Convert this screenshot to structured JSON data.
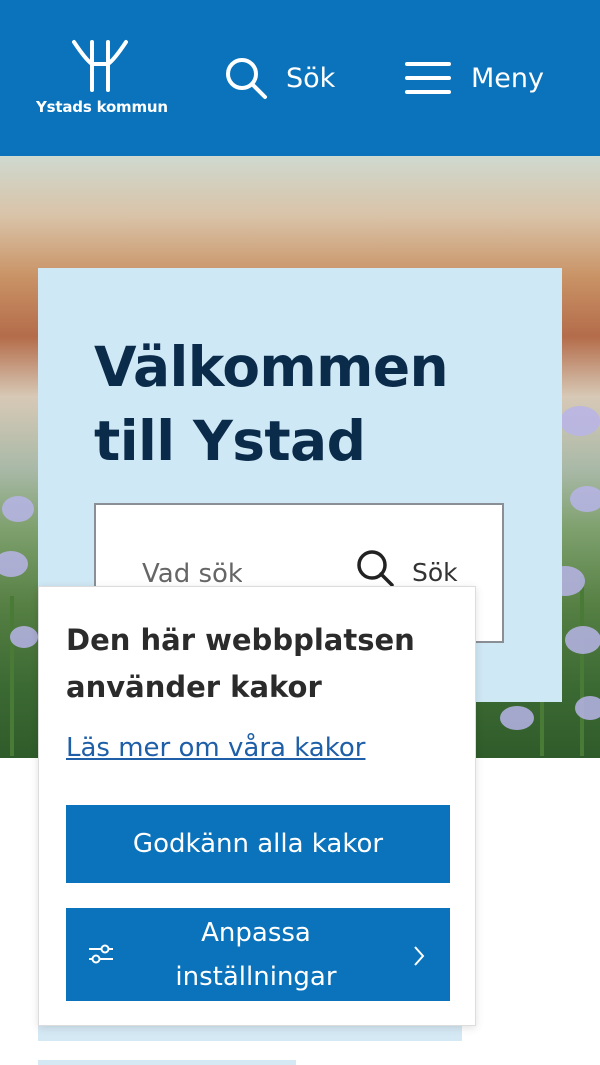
{
  "header": {
    "logo_text": "Ystads kommun",
    "search_label": "Sök",
    "menu_label": "Meny"
  },
  "welcome": {
    "title_line1": "Välkommen",
    "title_line2": "till Ystad",
    "search_placeholder": "Vad söker du efter?",
    "search_button": "Sök"
  },
  "cookie_banner": {
    "title": "Den här webbplatsen använder kakor",
    "read_more_link": "Läs mer om våra kakor",
    "accept_all_button": "Godkänn alla kakor",
    "customize_button": "Anpassa inställningar"
  },
  "colors": {
    "brand_blue": "#0a73bb",
    "welcome_bg": "#cfe8f5",
    "title_navy": "#0b2b4b"
  }
}
